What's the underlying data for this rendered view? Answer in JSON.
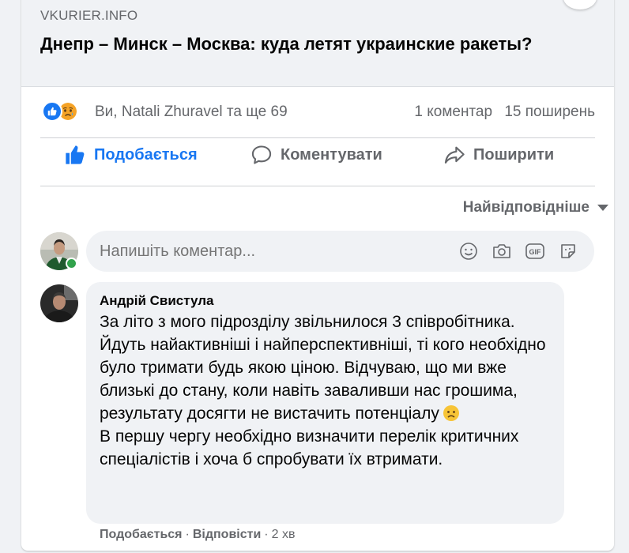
{
  "link_preview": {
    "domain": "VKURIER.INFO",
    "title": "Днепр – Минск – Москва: куда летят украинские ракеты?"
  },
  "reactions": {
    "icons": [
      "like-icon",
      "sad-icon"
    ],
    "names": "Ви, Natali Zhuravel та ще 69",
    "comments": "1 коментар",
    "shares": "15 поширень"
  },
  "actions": {
    "like": "Подобається",
    "comment": "Коментувати",
    "share": "Поширити"
  },
  "sort": {
    "label": "Найвідповідніше"
  },
  "composer": {
    "placeholder": "Напишіть коментар...",
    "icons": [
      "emoji-icon",
      "camera-icon",
      "gif-icon",
      "sticker-icon"
    ]
  },
  "comment": {
    "author": "Андрій Свистула",
    "paragraph1": "За літо з мого підрозділу звільнилося 3 співробітника. Йдуть найактивніші і найперспективніші, ті кого необхідно було тримати будь якою ціною. Відчуваю, що ми вже близькі до стану, коли навіть заваливши нас грошима, результату досягти не вистачить потенціалу",
    "paragraph2": "В першу чергу необхідно визначити перелік критичних спеціалістів і хоча б спробувати їх втримати.",
    "like_link": "Подобається",
    "reply_link": "Відповісти",
    "time": "2 хв"
  },
  "colors": {
    "accent": "#1877f2",
    "secondary_text": "#65676b",
    "bubble": "#f0f2f5",
    "online": "#31a24c"
  }
}
